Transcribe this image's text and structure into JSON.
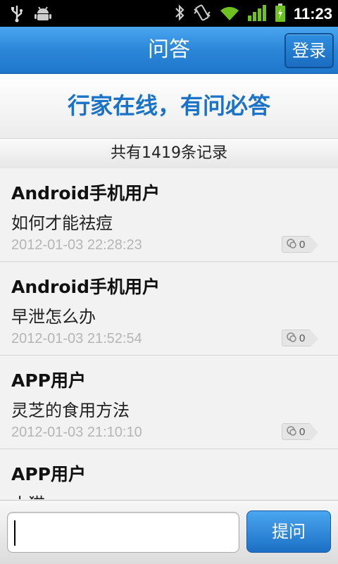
{
  "status_bar": {
    "time": "11:23"
  },
  "header": {
    "title": "问答",
    "login_label": "登录"
  },
  "slogan": "行家在线，有问必答",
  "record_count": "共有1419条记录",
  "items": [
    {
      "author": "Android手机用户",
      "question": "如何才能祛痘",
      "time": "2012-01-03 22:28:23",
      "comments": "0"
    },
    {
      "author": "Android手机用户",
      "question": "早泄怎么办",
      "time": "2012-01-03 21:52:54",
      "comments": "0"
    },
    {
      "author": "APP用户",
      "question": "灵芝的食用方法",
      "time": "2012-01-03 21:10:10",
      "comments": "0"
    },
    {
      "author": "APP用户",
      "question": "小猫",
      "time": "",
      "comments": ""
    }
  ],
  "input": {
    "value": "",
    "placeholder": ""
  },
  "ask_label": "提问",
  "colors": {
    "accent": "#1f77cc",
    "slogan": "#1a73c9"
  }
}
